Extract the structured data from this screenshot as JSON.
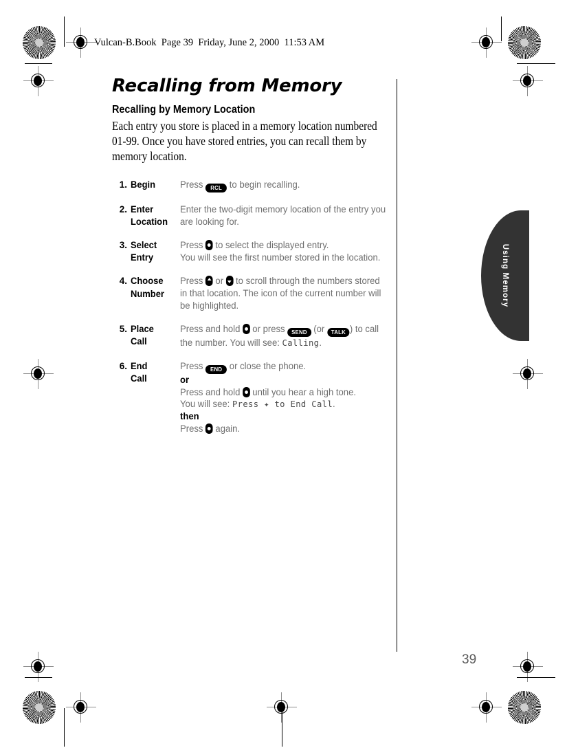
{
  "file_header": "Vulcan-B.Book  Page 39  Friday, June 2, 2000  11:53 AM",
  "title": "Recalling from Memory",
  "subtitle": "Recalling by Memory Location",
  "intro": "Each entry you store is placed in a memory location numbered 01-99. Once you have stored entries, you can recall them by memory location.",
  "side_tab": {
    "label": "Using Memory"
  },
  "folio": "39",
  "keys": {
    "rcl": "RCL",
    "send": "SEND",
    "talk": "TALK",
    "end": "END"
  },
  "steps": [
    {
      "number": "1.",
      "label": "Begin",
      "lines": [
        {
          "pre": "Press ",
          "key": "rcl",
          "post": " to begin recalling."
        }
      ]
    },
    {
      "number": "2.",
      "label": "Enter Location",
      "lines": [
        {
          "pre": "Enter the two-digit memory location of the entry you are looking for.",
          "key": "",
          "post": ""
        }
      ]
    },
    {
      "number": "3.",
      "label": "Select Entry",
      "lines": [
        {
          "pre": "Press ",
          "key": "nav-select",
          "post": " to select the displayed entry."
        },
        {
          "pre": "You will see the first number stored in the location.",
          "key": "",
          "post": ""
        }
      ]
    },
    {
      "number": "4.",
      "label": "Choose Number",
      "lines": [
        {
          "pre": "Press ",
          "key": "nav-up",
          "post": " or "
        },
        {
          "pre": "",
          "key": "nav-down",
          "post": " to scroll through the numbers stored in that location. The icon of the current number will be highlighted."
        }
      ]
    },
    {
      "number": "5.",
      "label": "Place Call",
      "lines": [
        {
          "pre": "Press and hold ",
          "key": "nav-select",
          "post": " or press "
        },
        {
          "pre": "",
          "key": "send",
          "post": " (or "
        },
        {
          "pre": "",
          "key": "talk",
          "post": ") to call the number. You will see: "
        },
        {
          "lcd": "Calling",
          "post": "."
        }
      ]
    },
    {
      "number": "6.",
      "label": "End Call",
      "lines": [
        {
          "pre": "Press ",
          "key": "end",
          "post": " or close the phone."
        },
        {
          "bold": "or"
        },
        {
          "pre": "Press and hold ",
          "key": "nav-select",
          "post": " until you hear a high tone."
        },
        {
          "pre": "You will see: ",
          "lcd": "Press ✦ to End Call",
          "post": "."
        },
        {
          "bold": "then"
        },
        {
          "pre": "Press ",
          "key": "nav-select",
          "post": " again."
        }
      ]
    }
  ],
  "step_text": {
    "s1_pre": "Press ",
    "s1_post": " to begin recalling.",
    "s2_all": "Enter the two-digit memory location of the entry you are looking for.",
    "s3_pre": "Press ",
    "s3_mid": " to select the displayed entry.",
    "s3_line2": "You will see the first number stored in the location.",
    "s4_pre": "Press ",
    "s4_or": " or ",
    "s4_post": " to scroll through the numbers stored in that location. The icon of the current number will be highlighted.",
    "s5_pre": "Press and hold ",
    "s5_or": " or press ",
    "s5_paren_open": " (or ",
    "s5_paren_close": ") to call the number. You will see: ",
    "s5_lcd": "Calling",
    "s5_period": ".",
    "s6_pre": "Press ",
    "s6_post": " or close the phone.",
    "s6_or": "or",
    "s6_hold_pre": "Press and hold ",
    "s6_hold_post": " until you hear a high tone.",
    "s6_see_pre": "You will see: ",
    "s6_lcd": "Press ✦ to End Call",
    "s6_see_post": ".",
    "s6_then": "then",
    "s6_again_pre": "Press ",
    "s6_again_post": " again."
  }
}
